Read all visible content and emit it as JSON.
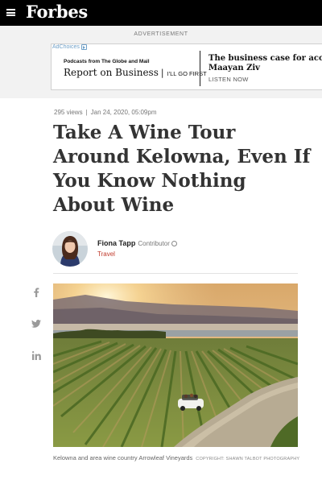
{
  "header": {
    "logo": "Forbes",
    "menu_icon": "hamburger-menu-icon"
  },
  "ad": {
    "label": "ADVERTISEMENT",
    "adchoices": "AdChoices",
    "sponsor_line": "Podcasts from The Globe and Mail",
    "brand": "Report on Business",
    "brand_tag": "I'LL GO FIRST",
    "headline_1": "The business case for access",
    "headline_2": "Maayan Ziv",
    "cta": "LISTEN NOW"
  },
  "article": {
    "views": "295 views",
    "separator": "|",
    "date": "Jan 24, 2020, 05:09pm",
    "title": "Take A Wine Tour Around Kelowna, Even If You Know Nothing About Wine",
    "author": {
      "name": "Fiona Tapp",
      "role": "Contributor",
      "section": "Travel"
    },
    "image_caption": "Kelowna and area wine country Arrowleaf Vineyards",
    "image_credit": "COPYRIGHT: SHAWN TALBOT PHOTOGRAPHY"
  },
  "share": {
    "icons": [
      "facebook-icon",
      "twitter-icon",
      "linkedin-icon"
    ]
  },
  "colors": {
    "topbar": "#000000",
    "ad_band": "#f2f2f2",
    "title_text": "#333333",
    "section_link": "#c0392b"
  }
}
